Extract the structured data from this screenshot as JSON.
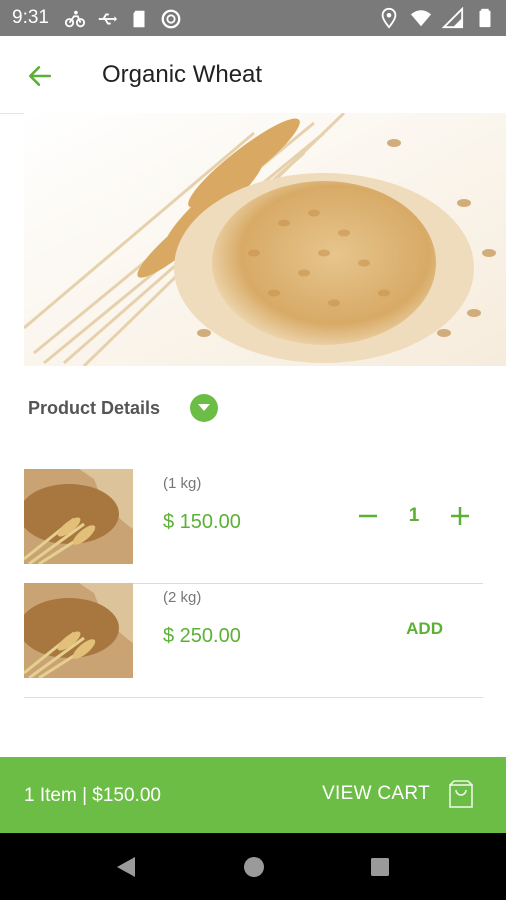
{
  "status_bar": {
    "time": "9:31",
    "left_icons": [
      "bike-icon",
      "usb-icon",
      "sd-card-icon",
      "sync-icon"
    ],
    "right_icons": [
      "location-icon",
      "wifi-icon",
      "signal-icon",
      "battery-icon"
    ]
  },
  "app_bar": {
    "title": "Organic Wheat",
    "back_icon": "arrow-left-icon"
  },
  "product": {
    "details_label": "Product Details"
  },
  "variants": [
    {
      "weight": "(1 kg)",
      "price": "$ 150.00",
      "quantity": "1"
    },
    {
      "weight": "(2 kg)",
      "price": "$ 250.00",
      "add_label": "ADD"
    }
  ],
  "cart": {
    "summary": "1 Item | $150.00",
    "action_label": "VIEW CART"
  },
  "colors": {
    "accent": "#6cbd45",
    "price_green": "#5cb135",
    "status_bar": "#7a7a7a",
    "nav_bar": "#000000"
  }
}
